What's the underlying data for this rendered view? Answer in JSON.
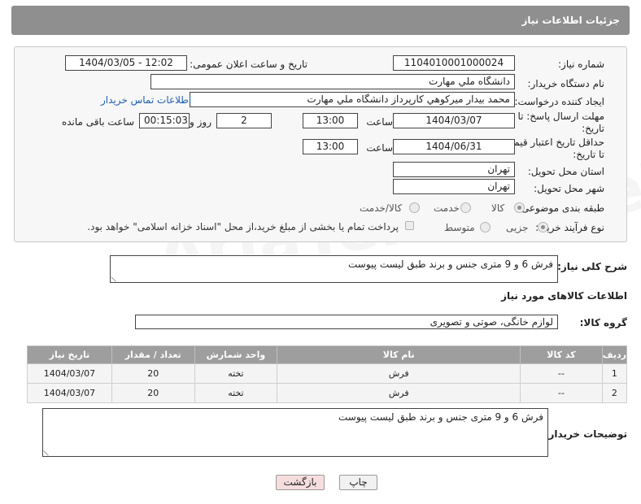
{
  "header": {
    "title": "جزئیات اطلاعات نیاز"
  },
  "fields": {
    "need_number_label": "شماره نیاز:",
    "need_number": "1104010001000024",
    "announce_label": "تاریخ و ساعت اعلان عمومی:",
    "announce_value": "1404/03/05 - 12:02",
    "buyer_org_label": "نام دستگاه خریدار:",
    "buyer_org": "دانشگاه ملي مهارت",
    "creator_label": "ایجاد کننده درخواست:",
    "creator": "محمد بيدار ميركوهي كارپرداز دانشگاه ملي مهارت",
    "contact_link": "اطلاعات تماس خریدار",
    "deadline_label_1": "مهلت ارسال پاسخ: تا",
    "deadline_label_2": "تاریخ:",
    "deadline_date": "1404/03/07",
    "time_label": "ساعت",
    "deadline_time": "13:00",
    "days_value": "2",
    "days_label": "روز و",
    "remaining_value": "00:15:03",
    "remaining_label": "ساعت باقی مانده",
    "price_valid_label_1": "حداقل تاریخ اعتبار قیمت:",
    "price_valid_label_2": "تا تاریخ:",
    "price_valid_date": "1404/06/31",
    "price_valid_time": "13:00",
    "province_label": "استان محل تحویل:",
    "province": "تهران",
    "city_label": "شهر محل تحویل:",
    "city": "تهران",
    "category_label": "طبقه بندی موضوعی:",
    "category_options": [
      "کالا",
      "خدمت",
      "کالا/خدمت"
    ],
    "process_label": "نوع فرآیند خرید :",
    "process_options": [
      "جزیی",
      "متوسط"
    ],
    "payment_note": "پرداخت تمام یا بخشی از مبلغ خرید،از محل \"اسناد خزانه اسلامی\" خواهد بود."
  },
  "summary": {
    "label": "شرح کلی نیاز:",
    "value": "فرش 6 و 9 متری جنس و برند طبق لیست پیوست"
  },
  "goods_section": {
    "title": "اطلاعات کالاهای مورد نیاز",
    "group_label": "گروه کالا:",
    "group_value": "لوازم خانگی، صوتی و تصویری"
  },
  "table": {
    "headers": [
      "ردیف",
      "کد کالا",
      "نام کالا",
      "واحد شمارش",
      "تعداد / مقدار",
      "تاریخ نیاز"
    ],
    "rows": [
      [
        "1",
        "--",
        "فرش",
        "تخته",
        "20",
        "1404/03/07"
      ],
      [
        "2",
        "--",
        "فرش",
        "تخته",
        "20",
        "1404/03/07"
      ]
    ]
  },
  "buyer_notes": {
    "label": "توضیحات خریدار:",
    "value": "فرش 6 و 9 متری جنس و برند طبق لیست پیوست"
  },
  "buttons": {
    "print": "چاپ",
    "back": "بازگشت"
  },
  "watermark": "AriaTender.neT",
  "colors": {
    "header_bg": "#8f8f8f",
    "link": "#1f5fb0",
    "back_btn_bg": "#f7dede",
    "print_btn_bg": "#f1f1f1"
  }
}
